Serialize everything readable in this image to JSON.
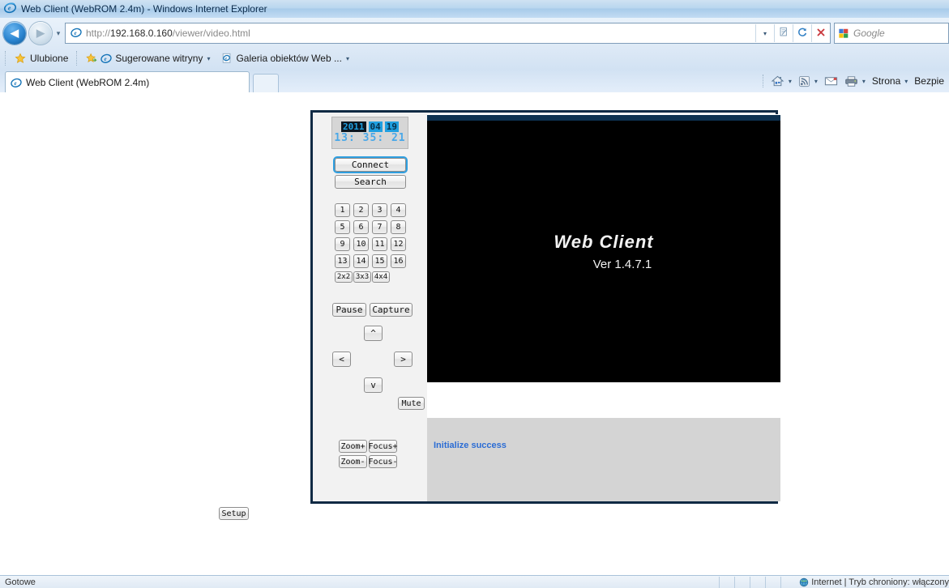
{
  "window": {
    "title": "Web Client (WebROM 2.4m) - Windows Internet Explorer",
    "ie_icon": "ie-logo-icon"
  },
  "nav": {
    "back_label": "◀",
    "forward_label": "▶",
    "recent_caret": "▾",
    "address_scheme": "http://",
    "address_host": "192.168.0.160",
    "address_path": "/viewer/video.html",
    "address_full": "http://192.168.0.160/viewer/video.html",
    "dropdown_caret": "▾",
    "compat_icon": "compatibility-view-icon",
    "refresh_icon": "refresh-icon",
    "stop_icon": "stop-icon",
    "search_provider": "Google",
    "search_placeholder": "Google"
  },
  "favorites_bar": {
    "favorites_label": "Ulubione",
    "items": [
      {
        "label": "Sugerowane witryny",
        "icon": "ie-feed-icon",
        "caret": "▾"
      },
      {
        "label": "Galeria obiektów Web ...",
        "icon": "web-gallery-icon",
        "caret": "▾"
      }
    ]
  },
  "tabs": [
    {
      "label": "Web Client (WebROM 2.4m)",
      "icon": "ie-page-icon",
      "active": true
    }
  ],
  "new_tab_label": "",
  "command_bar": {
    "home_icon": "home-icon",
    "feeds_icon": "feeds-icon",
    "mail_icon": "mail-icon",
    "print_icon": "print-icon",
    "caret": "▾",
    "page_menu": "Strona",
    "safety_menu": "Bezpie"
  },
  "client": {
    "clock": {
      "year": "2011",
      "month": "04",
      "day": "19",
      "time": "13: 35: 21"
    },
    "connect_label": "Connect",
    "search_label": "Search",
    "channels": [
      [
        "1",
        "2",
        "3",
        "4"
      ],
      [
        "5",
        "6",
        "7",
        "8"
      ],
      [
        "9",
        "10",
        "11",
        "12"
      ],
      [
        "13",
        "14",
        "15",
        "16"
      ]
    ],
    "layouts": [
      "2x2",
      "3x3",
      "4x4"
    ],
    "pause_label": "Pause",
    "capture_label": "Capture",
    "ptz": {
      "up": "^",
      "left": "<",
      "right": ">",
      "down": "v"
    },
    "mute_label": "Mute",
    "zoom_in_label": "Zoom+",
    "zoom_out_label": "Zoom-",
    "focus_in_label": "Focus+",
    "focus_out_label": "Focus-",
    "video": {
      "title": "Web  Client",
      "version": "Ver 1.4.7.1"
    },
    "status_message": "Initialize success",
    "setup_label": "Setup"
  },
  "status_bar": {
    "left_text": "Gotowe",
    "zone_text": "Internet | Tryb chroniony: włączony",
    "zone_icon": "globe-icon"
  },
  "colors": {
    "accent_blue": "#1f9fe0",
    "status_blue": "#2b6cd4",
    "frame_navy": "#102a44",
    "video_black": "#000000"
  }
}
